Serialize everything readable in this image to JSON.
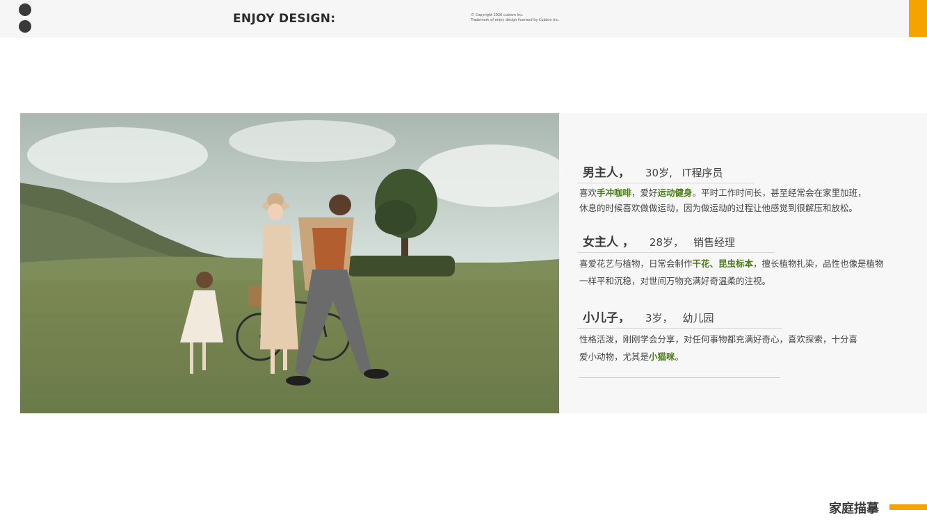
{
  "header": {
    "brand": "ENJOY DESIGN:",
    "copyright_line1": "©    Copyright 2020 cubism Inc.",
    "copyright_line2": "Trademark of enjoy design licensed by Cubism Inc."
  },
  "photo": {
    "subject": "family-photo"
  },
  "members": [
    {
      "name": "男主人，",
      "age": "30岁,",
      "job": "IT程序员",
      "desc_line1_a": "喜欢",
      "desc_line1_hl1": "手冲咖啡",
      "desc_line1_b": "，爱好",
      "desc_line1_hl2": "运动健身",
      "desc_line1_c": "。平时工作时间长，甚至经常会在家里加班，",
      "desc_line2": "休息的时候喜欢做做运动，因为做运动的过程让他感觉到很解压和放松。"
    },
    {
      "name": "女主人 ，",
      "age": "28岁，",
      "job": "销售经理",
      "desc_line1_a": "喜爱花艺与植物，日常会制作",
      "desc_line1_hl1": "干花、昆虫标本",
      "desc_line1_b": "，擅长植物扎染，品性也像是植物",
      "desc_line2": "一样平和沉稳，对世间万物充满好奇温柔的注视。"
    },
    {
      "name": "小儿子，",
      "age": "3岁，",
      "job": "幼儿园",
      "desc_line1": "性格活泼，刚刚学会分享，对任何事物都充满好奇心，喜欢探索，十分喜",
      "desc_line2_a": "爱小动物，尤其是",
      "desc_line2_hl": "小猫咪",
      "desc_line2_b": "。"
    }
  ],
  "footer": {
    "title": "家庭描摹"
  },
  "colors": {
    "accent": "#f5a300",
    "highlight": "#4a7a1a"
  }
}
